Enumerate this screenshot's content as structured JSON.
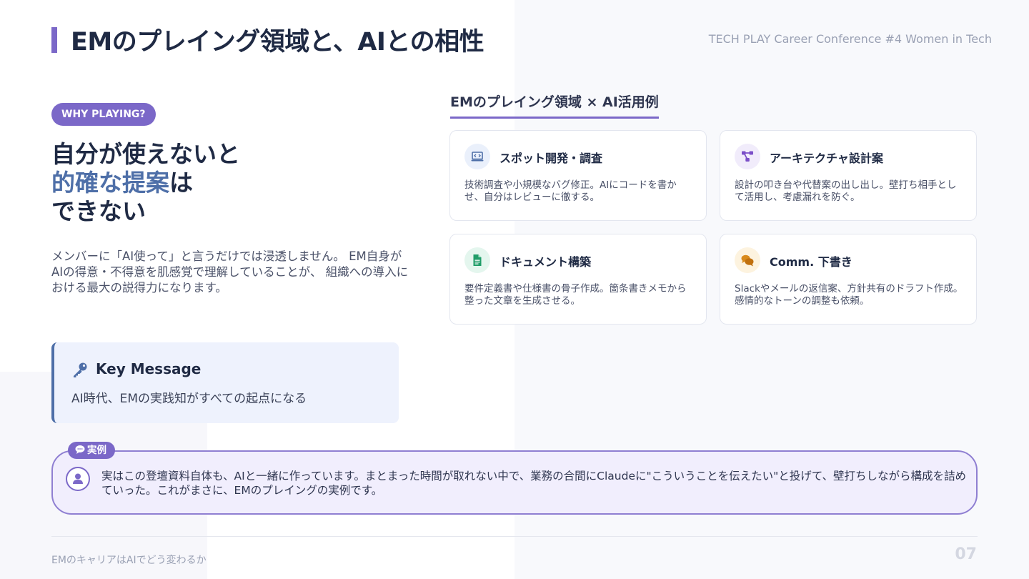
{
  "header": {
    "title": "EMのプレイング領域と、AIとの相性",
    "conference": "TECH PLAY Career Conference #4 Women in Tech"
  },
  "left": {
    "tag": "WHY PLAYING?",
    "headline_line1": "自分が使えないと",
    "headline_highlight": "的確な提案",
    "headline_line2_suffix": "は",
    "headline_line3": "できない",
    "description": "メンバーに「AI使って」と言うだけでは浸透しません。 EM自身がAIの得意・不得意を肌感覚で理解していることが、 組織への導入における最大の説得力になります。",
    "key_message": {
      "title": "Key Message",
      "text": "AI時代、EMの実践知がすべての起点になる"
    }
  },
  "right": {
    "section_title": "EMのプレイング領域 × AI活用例",
    "cards": [
      {
        "title": "スポット開発・調査",
        "description": "技術調査や小規模なバグ修正。AIにコードを書かせ、自分はレビューに徹する。",
        "icon": "code-laptop-icon"
      },
      {
        "title": "アーキテクチャ設計案",
        "description": "設計の叩き台や代替案の出し出し。壁打ち相手として活用し、考慮漏れを防ぐ。",
        "icon": "diagram-icon"
      },
      {
        "title": "ドキュメント構築",
        "description": "要件定義書や仕様書の骨子作成。箇条書きメモから整った文章を生成させる。",
        "icon": "document-icon"
      },
      {
        "title": "Comm. 下書き",
        "description": "Slackやメールの返信案、方針共有のドラフト作成。感情的なトーンの調整も依頼。",
        "icon": "chat-bubbles-icon"
      }
    ]
  },
  "example": {
    "tag": "実例",
    "text": "実はこの登壇資料自体も、AIと一緒に作っています。まとまった時間が取れない中で、業務の合間にClaudeに\"こういうことを伝えたい\"と投げて、壁打ちしながら構成を詰めていった。これがまさに、EMのプレイングの実例です。"
  },
  "footer": {
    "left": "EMのキャリアはAIでどう変わるか",
    "page": "07"
  },
  "colors": {
    "accent": "#7b68c8",
    "highlight": "#4e6fa8",
    "text": "#1f2a44"
  }
}
